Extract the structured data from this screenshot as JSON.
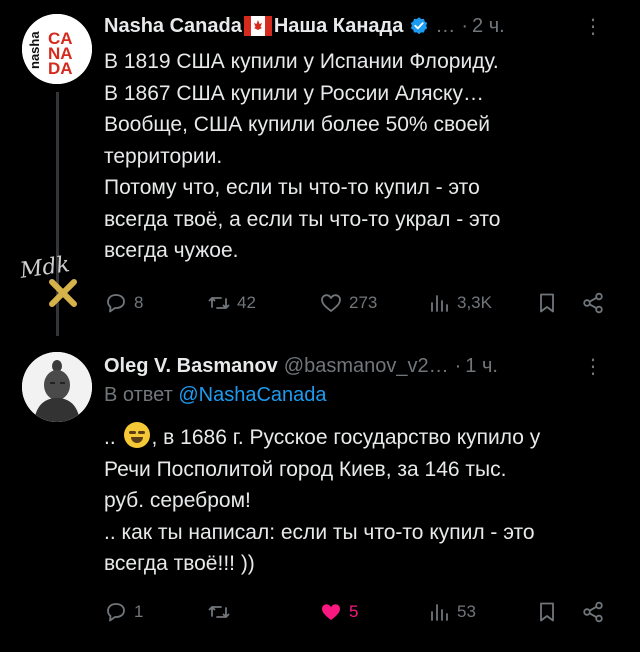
{
  "tweets": [
    {
      "author_name": "Nasha Canada",
      "author_name_ru": "Наша Канада",
      "handle": "…",
      "time": "2 ч.",
      "avatar_text": [
        "nasha",
        "CA",
        "NA",
        "DA"
      ],
      "lines": [
        "В 1819 США купили у Испании Флориду.",
        "В 1867 США купили у России Аляску…",
        "Вообще, США купили более 50% своей",
        "территории.",
        "Потому что, если ты что-то купил - это",
        "всегда твоё, а если ты что-то украл - это",
        "всегда чужое."
      ],
      "actions": {
        "replies": "8",
        "reposts": "42",
        "likes": "273",
        "views": "3,3K"
      },
      "watermark": "Mdk"
    },
    {
      "author_name": "Oleg V. Basmanov",
      "handle": "@basmanov_v2…",
      "time": "1 ч.",
      "reply_prefix": "В ответ",
      "reply_to": "@NashaCanada",
      "line1_a": "..",
      "line1_b": ", в 1686 г. Русское государство купило у",
      "lines": [
        "Речи Посполитой город Киев, за 146 тыс.",
        "руб. серебром!",
        ".. как ты написал: если ты что-то купил - это",
        "всегда твоё!!! ))"
      ],
      "actions": {
        "replies": "1",
        "reposts": "",
        "likes": "5",
        "views": "53"
      }
    }
  ],
  "colors": {
    "background": "#000000",
    "text": "#e7e9ea",
    "muted": "#71767b",
    "link": "#1d9bf0",
    "like_active": "#f91880",
    "canada_red": "#d52b1e"
  }
}
